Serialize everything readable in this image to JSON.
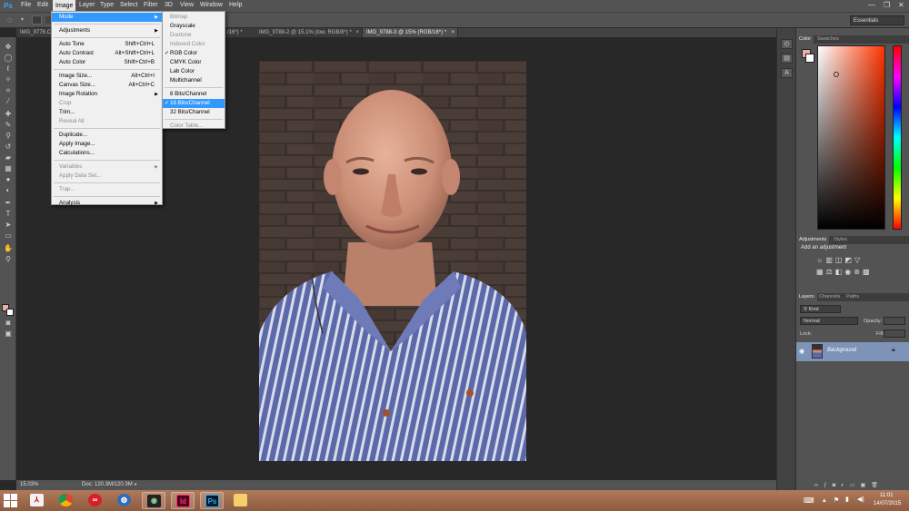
{
  "menubar": {
    "logo": "Ps",
    "items": [
      "File",
      "Edit",
      "Image",
      "Layer",
      "Type",
      "Select",
      "Filter",
      "3D",
      "View",
      "Window",
      "Help"
    ],
    "active": "Image"
  },
  "optionsbar": {
    "workspace": "Essentials"
  },
  "tabs": [
    {
      "label": "IMG_9776.C",
      "active": false
    },
    {
      "label": "/16*) *",
      "active": false
    },
    {
      "label": "IMG_9788-2 @ 15.1% (low, RGB/8*) *",
      "active": false
    },
    {
      "label": "IMG_9788-3 @ 15% (RGB/16*) *",
      "active": true
    }
  ],
  "image_menu": [
    {
      "label": "Mode",
      "arrow": true,
      "highlight": true
    },
    {
      "sep": true
    },
    {
      "label": "Adjustments",
      "arrow": true
    },
    {
      "sep": true
    },
    {
      "label": "Auto Tone",
      "shortcut": "Shift+Ctrl+L"
    },
    {
      "label": "Auto Contrast",
      "shortcut": "Alt+Shift+Ctrl+L"
    },
    {
      "label": "Auto Color",
      "shortcut": "Shift+Ctrl+B"
    },
    {
      "sep": true
    },
    {
      "label": "Image Size...",
      "shortcut": "Alt+Ctrl+I"
    },
    {
      "label": "Canvas Size...",
      "shortcut": "Alt+Ctrl+C"
    },
    {
      "label": "Image Rotation",
      "arrow": true
    },
    {
      "label": "Crop",
      "disabled": true
    },
    {
      "label": "Trim..."
    },
    {
      "label": "Reveal All",
      "disabled": true
    },
    {
      "sep": true
    },
    {
      "label": "Duplicate..."
    },
    {
      "label": "Apply Image..."
    },
    {
      "label": "Calculations..."
    },
    {
      "sep": true
    },
    {
      "label": "Variables",
      "arrow": true,
      "disabled": true
    },
    {
      "label": "Apply Data Set...",
      "disabled": true
    },
    {
      "sep": true
    },
    {
      "label": "Trap...",
      "disabled": true
    },
    {
      "sep": true
    },
    {
      "label": "Analysis",
      "arrow": true
    }
  ],
  "mode_menu": [
    {
      "label": "Bitmap",
      "disabled": true
    },
    {
      "label": "Grayscale"
    },
    {
      "label": "Duotone",
      "disabled": true
    },
    {
      "label": "Indexed Color",
      "disabled": true
    },
    {
      "label": "RGB Color",
      "checked": true
    },
    {
      "label": "CMYK Color"
    },
    {
      "label": "Lab Color"
    },
    {
      "label": "Multichannel"
    },
    {
      "sep": true
    },
    {
      "label": "8 Bits/Channel"
    },
    {
      "label": "16 Bits/Channel",
      "checked": true,
      "highlight": true
    },
    {
      "label": "32 Bits/Channel"
    },
    {
      "sep": true
    },
    {
      "label": "Color Table...",
      "disabled": true
    }
  ],
  "check_glyph": "✓",
  "panels": {
    "color_tabs": [
      "Color",
      "Swatches"
    ],
    "adjust_tabs": [
      "Adjustments",
      "Styles"
    ],
    "adjust_title": "Add an adjustment",
    "layers_tabs": [
      "Layers",
      "Channels",
      "Paths"
    ],
    "kind_label": "Kind",
    "blend_mode": "Normal",
    "opacity_label": "Opacity:",
    "lock_label": "Lock:",
    "fill_label": "Fill:",
    "layer_name": "Background"
  },
  "status": {
    "zoom": "15.03%",
    "doc": "Doc: 120.3M/120.3M"
  },
  "taskbar": {
    "time": "11:01",
    "date": "14/07/2015"
  },
  "colors": {
    "accent": "#3399ff",
    "foreground": "#e8b1a8",
    "panel": "#535353"
  }
}
